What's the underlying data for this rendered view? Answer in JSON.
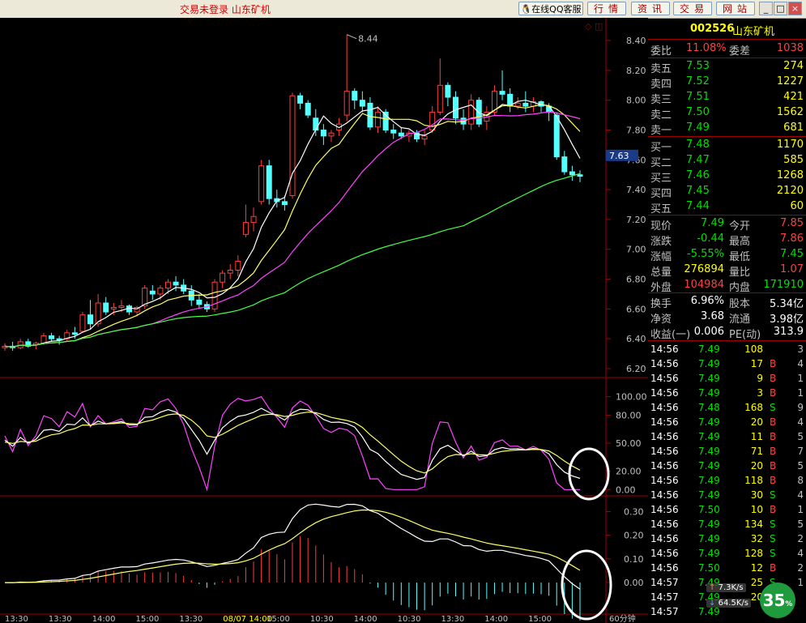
{
  "window": {
    "title": "交易未登录    山东矿机",
    "qq_label": "在线QQ客服",
    "buttons": [
      "行情",
      "资讯",
      "交易",
      "网站"
    ],
    "controls": {
      "min": "_",
      "max": "□",
      "close": "×"
    }
  },
  "stock": {
    "code": "002526",
    "name": "山东矿机"
  },
  "order_ratio": {
    "label1": "委比",
    "value1": "11.08%",
    "label2": "委差",
    "value2": "1038"
  },
  "asks": [
    {
      "label": "卖五",
      "price": "7.53",
      "vol": "274"
    },
    {
      "label": "卖四",
      "price": "7.52",
      "vol": "1227"
    },
    {
      "label": "卖三",
      "price": "7.51",
      "vol": "421"
    },
    {
      "label": "卖二",
      "price": "7.50",
      "vol": "1562"
    },
    {
      "label": "卖一",
      "price": "7.49",
      "vol": "681"
    }
  ],
  "bids": [
    {
      "label": "买一",
      "price": "7.48",
      "vol": "1170"
    },
    {
      "label": "买二",
      "price": "7.47",
      "vol": "585"
    },
    {
      "label": "买三",
      "price": "7.46",
      "vol": "1268"
    },
    {
      "label": "买四",
      "price": "7.45",
      "vol": "2120"
    },
    {
      "label": "买五",
      "price": "7.44",
      "vol": "60"
    }
  ],
  "quote": [
    {
      "l1": "现价",
      "v1": "7.49",
      "l2": "今开",
      "v2": "7.85",
      "c1": "#00e000",
      "c2": "#ff4040"
    },
    {
      "l1": "涨跌",
      "v1": "-0.44",
      "l2": "最高",
      "v2": "7.86",
      "c1": "#00e000",
      "c2": "#ff4040"
    },
    {
      "l1": "涨幅",
      "v1": "-5.55%",
      "l2": "最低",
      "v2": "7.45",
      "c1": "#00e000",
      "c2": "#00e000"
    },
    {
      "l1": "总量",
      "v1": "276894",
      "l2": "量比",
      "v2": "1.07",
      "c1": "#ffff00",
      "c2": "#ff4040"
    },
    {
      "l1": "外盘",
      "v1": "104984",
      "l2": "内盘",
      "v2": "171910",
      "c1": "#ff4040",
      "c2": "#00e000"
    }
  ],
  "fundamentals": [
    {
      "l1": "换手",
      "v1": "6.96%",
      "l2": "股本",
      "v2": "5.34亿"
    },
    {
      "l1": "净资",
      "v1": "3.68",
      "l2": "流通",
      "v2": "3.98亿"
    },
    {
      "l1": "收益(一)",
      "v1": "0.006",
      "l2": "PE(动)",
      "v2": "313.9"
    }
  ],
  "ticks": [
    {
      "t": "14:56",
      "p": "7.49",
      "v": "108",
      "bs": "",
      "n": "3"
    },
    {
      "t": "14:56",
      "p": "7.49",
      "v": "17",
      "bs": "B",
      "n": "4"
    },
    {
      "t": "14:56",
      "p": "7.49",
      "v": "9",
      "bs": "B",
      "n": "1"
    },
    {
      "t": "14:56",
      "p": "7.49",
      "v": "3",
      "bs": "B",
      "n": "1"
    },
    {
      "t": "14:56",
      "p": "7.48",
      "v": "168",
      "bs": "S",
      "n": "9"
    },
    {
      "t": "14:56",
      "p": "7.49",
      "v": "20",
      "bs": "B",
      "n": "4"
    },
    {
      "t": "14:56",
      "p": "7.49",
      "v": "11",
      "bs": "B",
      "n": "5"
    },
    {
      "t": "14:56",
      "p": "7.49",
      "v": "71",
      "bs": "B",
      "n": "7"
    },
    {
      "t": "14:56",
      "p": "7.49",
      "v": "20",
      "bs": "B",
      "n": "5"
    },
    {
      "t": "14:56",
      "p": "7.49",
      "v": "118",
      "bs": "B",
      "n": "8"
    },
    {
      "t": "14:56",
      "p": "7.49",
      "v": "30",
      "bs": "S",
      "n": "4"
    },
    {
      "t": "14:56",
      "p": "7.50",
      "v": "10",
      "bs": "B",
      "n": "1"
    },
    {
      "t": "14:56",
      "p": "7.49",
      "v": "134",
      "bs": "S",
      "n": "5"
    },
    {
      "t": "14:56",
      "p": "7.49",
      "v": "32",
      "bs": "S",
      "n": "2"
    },
    {
      "t": "14:56",
      "p": "7.49",
      "v": "128",
      "bs": "S",
      "n": "4"
    },
    {
      "t": "14:56",
      "p": "7.50",
      "v": "12",
      "bs": "B",
      "n": "2"
    },
    {
      "t": "14:57",
      "p": "7.49",
      "v": "25",
      "bs": "S",
      "n": "1"
    },
    {
      "t": "14:57",
      "p": "7.49",
      "v": "20",
      "bs": "",
      "n": ""
    },
    {
      "t": "14:57",
      "p": "7.49",
      "v": "",
      "bs": "",
      "n": ""
    }
  ],
  "network": {
    "up": "7.3K/s",
    "down": "64.5K/s",
    "percent": "35",
    "unit": "%"
  },
  "chart_data": {
    "type": "candlestick",
    "peak_label": "8.44",
    "last_price_tag": "7.63",
    "corner_icons": "◇ ◫",
    "price_axis": [
      "8.40",
      "8.20",
      "8.00",
      "7.80",
      "7.60",
      "7.40",
      "7.20",
      "7.00",
      "6.80",
      "6.60",
      "6.40",
      "6.20"
    ],
    "price_range": [
      6.14,
      8.52
    ],
    "candles": [
      [
        6.34,
        6.37,
        6.32,
        6.35
      ],
      [
        6.35,
        6.38,
        6.32,
        6.34
      ],
      [
        6.34,
        6.4,
        6.33,
        6.38
      ],
      [
        6.38,
        6.4,
        6.34,
        6.35
      ],
      [
        6.36,
        6.38,
        6.33,
        6.37
      ],
      [
        6.37,
        6.44,
        6.36,
        6.42
      ],
      [
        6.42,
        6.44,
        6.38,
        6.4
      ],
      [
        6.4,
        6.42,
        6.36,
        6.39
      ],
      [
        6.4,
        6.46,
        6.38,
        6.44
      ],
      [
        6.44,
        6.48,
        6.4,
        6.43
      ],
      [
        6.45,
        6.58,
        6.44,
        6.56
      ],
      [
        6.56,
        6.66,
        6.46,
        6.5
      ],
      [
        6.5,
        6.7,
        6.48,
        6.64
      ],
      [
        6.64,
        6.68,
        6.56,
        6.58
      ],
      [
        6.6,
        6.64,
        6.56,
        6.61
      ],
      [
        6.61,
        6.66,
        6.58,
        6.62
      ],
      [
        6.62,
        6.63,
        6.56,
        6.58
      ],
      [
        6.58,
        6.62,
        6.55,
        6.61
      ],
      [
        6.62,
        6.76,
        6.6,
        6.74
      ],
      [
        6.72,
        6.76,
        6.66,
        6.7
      ],
      [
        6.7,
        6.76,
        6.66,
        6.74
      ],
      [
        6.74,
        6.8,
        6.7,
        6.78
      ],
      [
        6.78,
        6.82,
        6.72,
        6.76
      ],
      [
        6.76,
        6.8,
        6.7,
        6.72
      ],
      [
        6.72,
        6.76,
        6.62,
        6.66
      ],
      [
        6.66,
        6.7,
        6.6,
        6.63
      ],
      [
        6.63,
        6.65,
        6.58,
        6.6
      ],
      [
        6.6,
        6.8,
        6.58,
        6.78
      ],
      [
        6.78,
        6.86,
        6.74,
        6.84
      ],
      [
        6.84,
        6.9,
        6.8,
        6.86
      ],
      [
        6.86,
        6.96,
        6.82,
        6.92
      ],
      [
        7.1,
        7.3,
        7.08,
        7.18
      ],
      [
        7.18,
        7.28,
        7.12,
        7.22
      ],
      [
        7.32,
        7.6,
        7.3,
        7.56
      ],
      [
        7.56,
        7.6,
        7.3,
        7.34
      ],
      [
        7.34,
        7.4,
        7.28,
        7.32
      ],
      [
        7.32,
        7.36,
        7.26,
        7.3
      ],
      [
        7.36,
        8.05,
        7.34,
        8.03
      ],
      [
        8.03,
        8.05,
        7.94,
        7.98
      ],
      [
        7.98,
        8.0,
        7.88,
        7.9
      ],
      [
        7.88,
        7.94,
        7.76,
        7.8
      ],
      [
        7.8,
        7.84,
        7.7,
        7.76
      ],
      [
        7.76,
        7.8,
        7.72,
        7.78
      ],
      [
        7.8,
        7.88,
        7.76,
        7.84
      ],
      [
        7.9,
        8.44,
        7.86,
        8.06
      ],
      [
        8.06,
        8.08,
        7.94,
        8.0
      ],
      [
        8.0,
        8.06,
        7.92,
        7.96
      ],
      [
        7.98,
        8.02,
        7.8,
        7.82
      ],
      [
        7.82,
        7.96,
        7.78,
        7.92
      ],
      [
        7.92,
        7.94,
        7.78,
        7.8
      ],
      [
        7.8,
        7.84,
        7.74,
        7.78
      ],
      [
        7.78,
        7.82,
        7.74,
        7.76
      ],
      [
        7.76,
        7.8,
        7.72,
        7.78
      ],
      [
        7.78,
        7.8,
        7.72,
        7.74
      ],
      [
        7.74,
        7.8,
        7.7,
        7.76
      ],
      [
        7.8,
        7.96,
        7.78,
        7.92
      ],
      [
        7.92,
        8.28,
        7.9,
        8.1
      ],
      [
        8.1,
        8.12,
        7.96,
        8.02
      ],
      [
        8.02,
        8.06,
        7.84,
        7.88
      ],
      [
        7.88,
        7.94,
        7.8,
        7.84
      ],
      [
        7.84,
        8.04,
        7.8,
        8.0
      ],
      [
        8.0,
        8.02,
        7.82,
        7.84
      ],
      [
        7.86,
        7.96,
        7.8,
        7.92
      ],
      [
        7.92,
        8.1,
        7.9,
        8.06
      ],
      [
        8.06,
        8.2,
        8.0,
        8.04
      ],
      [
        8.04,
        8.08,
        7.92,
        7.96
      ],
      [
        7.96,
        8.02,
        7.94,
        7.98
      ],
      [
        7.98,
        8.06,
        7.92,
        7.96
      ],
      [
        7.96,
        8.02,
        7.92,
        7.99
      ],
      [
        7.99,
        8.0,
        7.92,
        7.96
      ],
      [
        7.96,
        7.98,
        7.86,
        7.92
      ],
      [
        7.9,
        7.92,
        7.6,
        7.62
      ],
      [
        7.62,
        7.66,
        7.5,
        7.52
      ],
      [
        7.52,
        7.56,
        7.46,
        7.5
      ],
      [
        7.5,
        7.53,
        7.45,
        7.49
      ]
    ],
    "kdj_axis": [
      "100.00",
      "80.00",
      "50.00",
      "20.00",
      "0.00"
    ],
    "kdj_range": [
      -5,
      118
    ],
    "macd_axis": [
      "0.30",
      "0.20",
      "0.10",
      "0.00"
    ],
    "macd_range": [
      -0.13,
      0.36
    ],
    "time_labels": [
      "13:30",
      "13:30",
      "14:00",
      "15:00",
      "13:30",
      "08/07 14:00",
      "15:00",
      "10:30",
      "14:00",
      "10:30",
      "13:30",
      "14:00",
      "15:00",
      "60分钟"
    ]
  }
}
